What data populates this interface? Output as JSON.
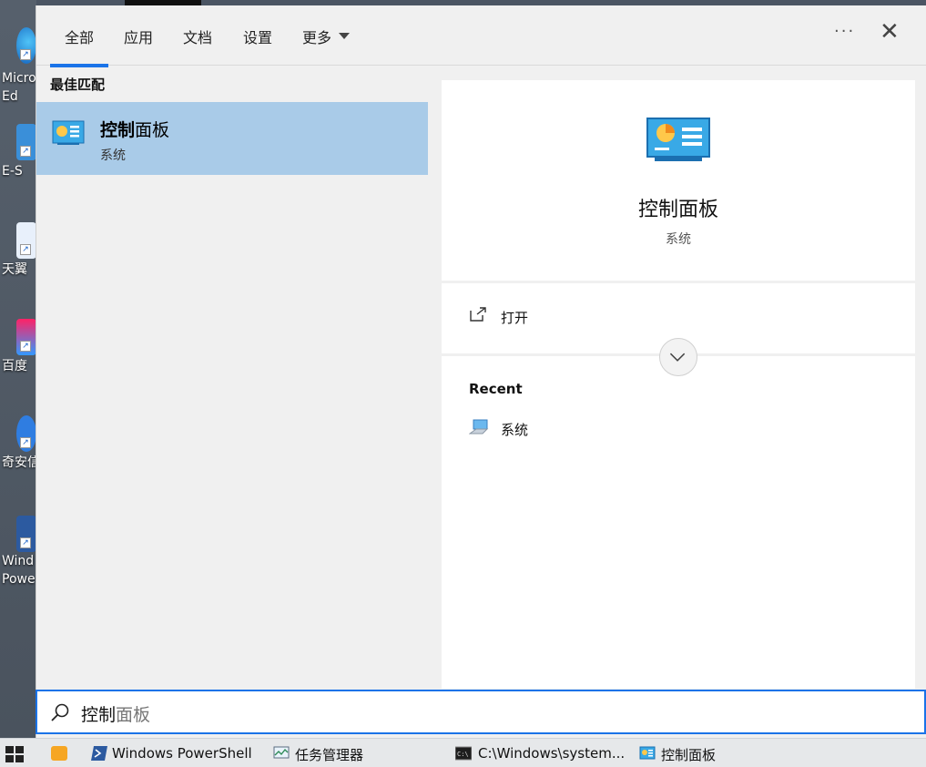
{
  "desktop": {
    "icons": [
      {
        "label": "Micro\nEd"
      },
      {
        "label": "E-S"
      },
      {
        "label": "天翼"
      },
      {
        "label": "百度"
      },
      {
        "label": "奇安信"
      },
      {
        "label": "Wind\nPowe"
      }
    ]
  },
  "tabs": [
    {
      "label": "全部"
    },
    {
      "label": "应用"
    },
    {
      "label": "文档"
    },
    {
      "label": "设置"
    },
    {
      "label": "更多"
    }
  ],
  "header": {
    "more_dots": "···",
    "close": "✕"
  },
  "best_match": {
    "section_label": "最佳匹配",
    "title_bold": "控制",
    "title_rest": "面板",
    "subtitle": "系统"
  },
  "detail": {
    "title": "控制面板",
    "subtitle": "系统",
    "open_label": "打开",
    "recent_label": "Recent",
    "recent_items": [
      {
        "label": "系统"
      }
    ]
  },
  "search": {
    "typed": "控制",
    "suggestion": "面板"
  },
  "taskbar": {
    "items": [
      {
        "label": "Windows PowerShell"
      },
      {
        "label": "任务管理器"
      },
      {
        "label": "C:\\Windows\\system..."
      },
      {
        "label": "控制面板"
      }
    ]
  },
  "colors": {
    "accent": "#1a73e8",
    "selected": "#a9cbe8",
    "panel_bg": "#f0f0f0"
  }
}
